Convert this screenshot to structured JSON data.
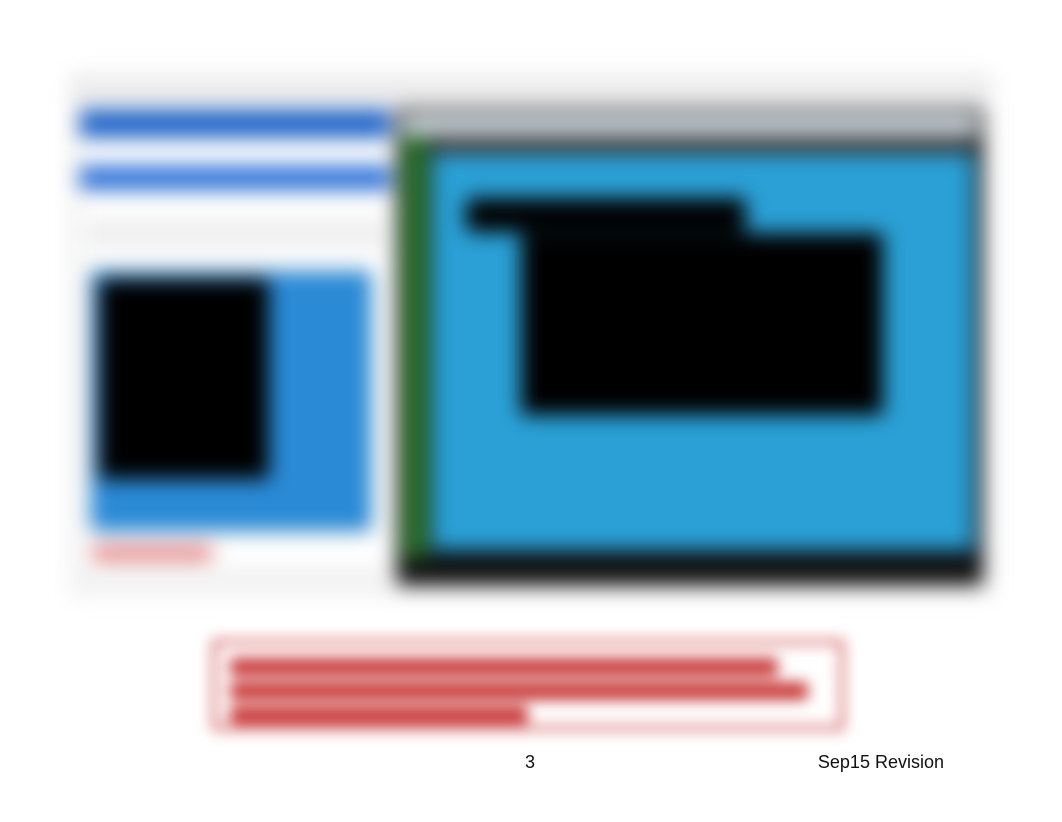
{
  "footer": {
    "page_number": "3",
    "revision": "Sep15 Revision"
  },
  "callout": {
    "line1": "",
    "line2": "",
    "line3": ""
  },
  "screenshot": {
    "left_panel": "",
    "right_panel_title": "",
    "terminal_output": ""
  }
}
